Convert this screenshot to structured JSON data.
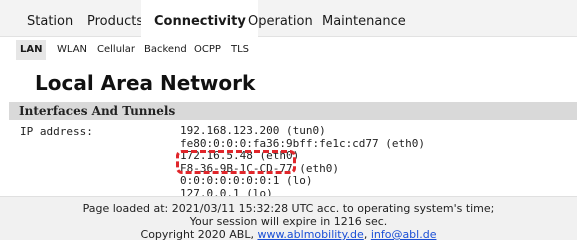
{
  "top_nav": {
    "tabs": [
      {
        "label": "Station",
        "active": false
      },
      {
        "label": "Products",
        "active": false
      },
      {
        "label": "Connectivity",
        "active": true
      },
      {
        "label": "Operation",
        "active": false
      },
      {
        "label": "Maintenance",
        "active": false
      }
    ]
  },
  "sub_nav": {
    "tabs": [
      {
        "label": "LAN",
        "active": true
      },
      {
        "label": "WLAN",
        "active": false
      },
      {
        "label": "Cellular",
        "active": false
      },
      {
        "label": "Backend",
        "active": false
      },
      {
        "label": "OCPP",
        "active": false
      },
      {
        "label": "TLS",
        "active": false
      }
    ]
  },
  "page": {
    "title": "Local Area Network"
  },
  "section": {
    "title": "Interfaces And Tunnels",
    "ip_label": "IP address:",
    "addresses": [
      "192.168.123.200 (tun0)",
      "fe80:0:0:0:fa36:9bff:fe1c:cd77 (eth0)",
      "172.16.5.48 (eth0)",
      "F8-36-9B-1C-CD-77 (eth0)",
      "0:0:0:0:0:0:0:1 (lo)",
      "127.0.0.1 (lo)"
    ],
    "highlight_color": "#e0262b"
  },
  "footer": {
    "line1": "Page loaded at: 2021/03/11 15:32:28 UTC acc. to operating system's time;",
    "line2": "Your session will expire in 1216 sec.",
    "copyright": "Copyright 2020 ABL,",
    "link_site": "www.ablmobility.de",
    "separator": ",",
    "link_email": "info@abl.de"
  }
}
